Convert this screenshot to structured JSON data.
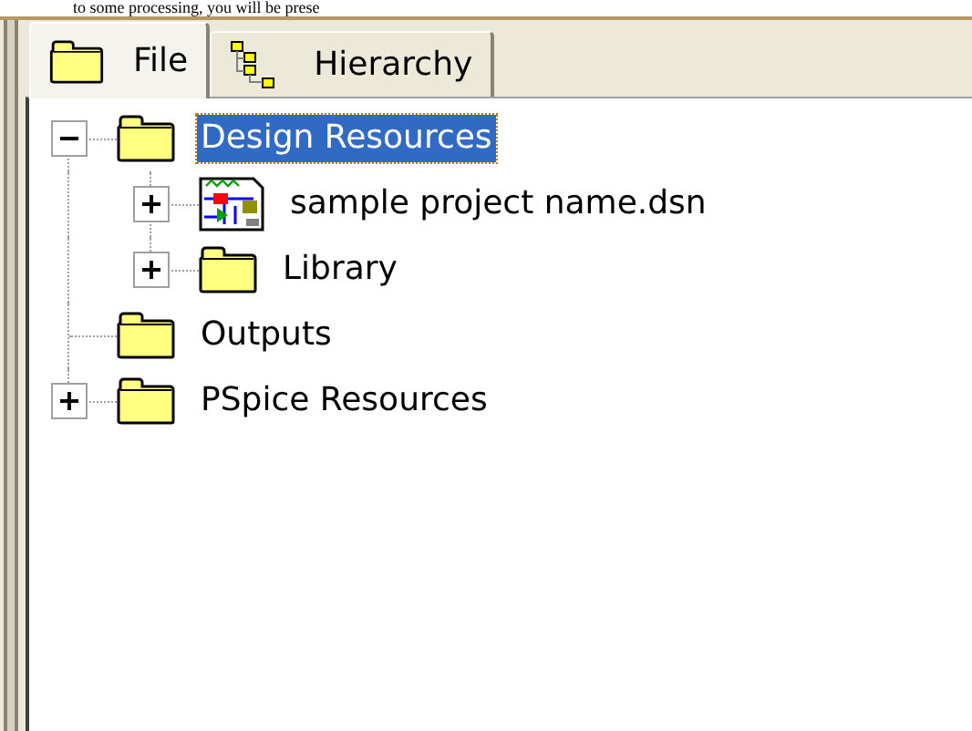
{
  "caption_text": "to some processing, you will be prese",
  "tabs": [
    {
      "label": "File",
      "kind": "folder",
      "selected": true
    },
    {
      "label": "Hierarchy",
      "kind": "hierarchy",
      "selected": false
    }
  ],
  "tree": [
    {
      "label": "Design Resources",
      "kind": "folder",
      "expanded": true,
      "selected": true,
      "children": [
        {
          "label": "sample project name.dsn",
          "kind": "design",
          "expanded": false,
          "selected": false
        },
        {
          "label": "Library",
          "kind": "folder",
          "expanded": false,
          "selected": false
        }
      ]
    },
    {
      "label": "Outputs",
      "kind": "folder",
      "selected": false
    },
    {
      "label": "PSpice Resources",
      "kind": "folder",
      "expanded": false,
      "selected": false
    }
  ]
}
